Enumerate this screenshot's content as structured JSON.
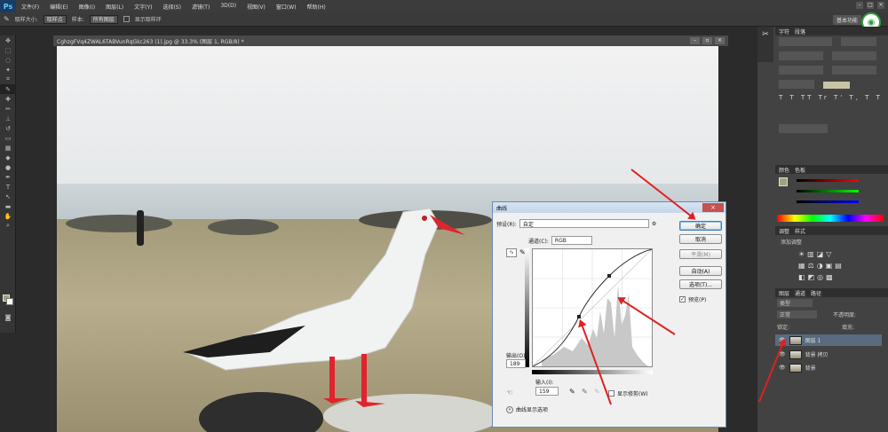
{
  "app": {
    "logo": "Ps",
    "menu": [
      "文件(F)",
      "编辑(E)",
      "图像(I)",
      "图层(L)",
      "文字(Y)",
      "选择(S)",
      "滤镜(T)",
      "3D(D)",
      "视图(V)",
      "窗口(W)",
      "帮助(H)"
    ],
    "workspace": "基本功能"
  },
  "options_bar": {
    "sample_size_label": "取样大小:",
    "sample_size_value": "取样点",
    "sample_label": "样本:",
    "sample_value": "所有图层",
    "show_ring": "显示取样环"
  },
  "document": {
    "tab_title": "CghzgFVq4ZWAL6TABVunRqGkc263 (1).jpg @ 33.3% (图层 1, RGB/8) *"
  },
  "curves_dialog": {
    "title": "曲线",
    "preset_label": "预设(R):",
    "preset_value": "自定",
    "channel_label": "通道(C):",
    "channel_value": "RGB",
    "output_label": "输出(O):",
    "output_value": "189",
    "input_label": "输入(I):",
    "input_value": "159",
    "ok": "确定",
    "cancel": "取消",
    "smooth": "平滑(M)",
    "auto": "自动(A)",
    "options": "选项(T)...",
    "preview": "预览(P)",
    "show_clipping": "显示修剪(W)",
    "curve_display": "曲线显示选项"
  },
  "right_panel": {
    "char_tabs": [
      "字符",
      "段落"
    ],
    "color_tabs": [
      "颜色",
      "色板"
    ],
    "adjust_tabs": [
      "调整",
      "样式"
    ],
    "adjust_add": "添加调整",
    "layers_tabs": [
      "图层",
      "通道",
      "路径"
    ],
    "blend_mode": "正常",
    "opacity_label": "不透明度:",
    "fill_label": "填充:",
    "lock_label": "锁定:",
    "kind_label": "类型",
    "layers": [
      "图层 1",
      "背景 拷贝",
      "背景"
    ]
  },
  "colors": {
    "fg_swatch": "#a2a27a",
    "accent_arrow": "#e02020",
    "dialog_border": "#6a8ab0"
  }
}
